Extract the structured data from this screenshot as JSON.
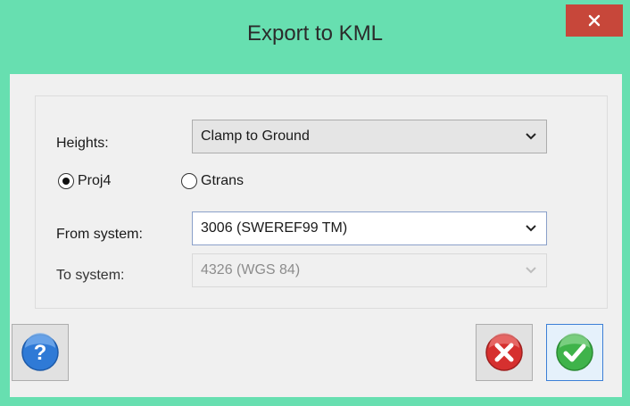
{
  "window": {
    "title": "Export to KML"
  },
  "heights": {
    "label": "Heights:",
    "value": "Clamp to Ground"
  },
  "radios": {
    "proj4": "Proj4",
    "gtrans": "Gtrans",
    "selected": "Proj4"
  },
  "from_system": {
    "label": "From system:",
    "value": "3006 (SWEREF99 TM)"
  },
  "to_system": {
    "label": "To system:",
    "value": "4326 (WGS 84)"
  },
  "icons": {
    "help": "help-icon",
    "cancel": "cancel-icon",
    "ok": "ok-check-icon",
    "close": "close-icon"
  },
  "colors": {
    "titlebar": "#67dfb0",
    "close": "#c7473a",
    "help": "#2f7ad6",
    "cancel": "#d6302f",
    "ok": "#3fb34a"
  }
}
